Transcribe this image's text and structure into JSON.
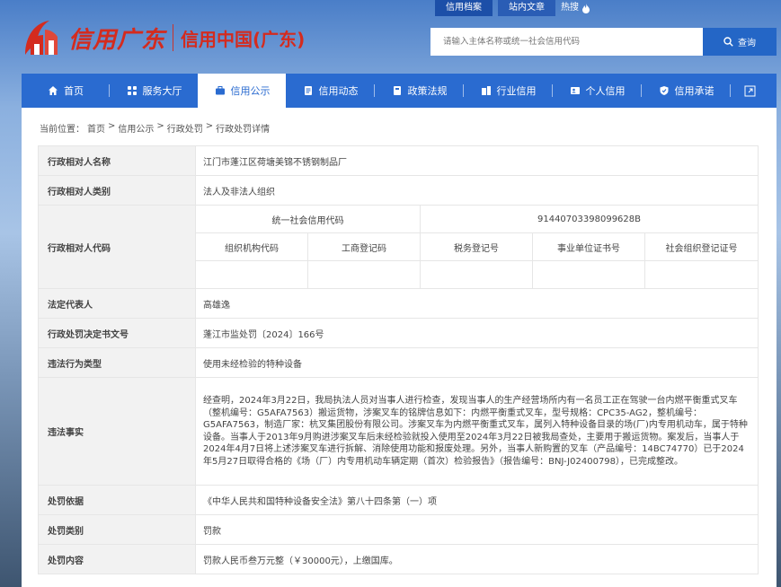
{
  "header": {
    "logo_script": "信用广东",
    "logo_title": "信用中国(广东)",
    "top_links": [
      "信用档案",
      "站内文章"
    ],
    "hot_label": "热搜",
    "search_placeholder": "请输入主体名称或统一社会信用代码",
    "search_button": "查询"
  },
  "nav": {
    "items": [
      {
        "label": "首页",
        "icon": "home-icon"
      },
      {
        "label": "服务大厅",
        "icon": "grid-icon"
      },
      {
        "label": "信用公示",
        "icon": "briefcase-icon",
        "active": true
      },
      {
        "label": "信用动态",
        "icon": "document-icon"
      },
      {
        "label": "政策法规",
        "icon": "book-icon"
      },
      {
        "label": "行业信用",
        "icon": "building-icon"
      },
      {
        "label": "个人信用",
        "icon": "person-card-icon"
      },
      {
        "label": "信用承诺",
        "icon": "shield-check-icon"
      }
    ],
    "expand_icon": "external-link-icon"
  },
  "breadcrumb": {
    "prefix": "当前位置：",
    "items": [
      "首页",
      "信用公示",
      "行政处罚",
      "行政处罚详情"
    ],
    "separator": ">"
  },
  "detail": {
    "name_label": "行政相对人名称",
    "name_value": "江门市蓬江区荷塘美锦不锈钢制品厂",
    "category_label": "行政相对人类别",
    "category_value": "法人及非法人组织",
    "code_label": "行政相对人代码",
    "uscc_label": "统一社会信用代码",
    "uscc_value": "91440703398099628B",
    "code_columns": [
      "组织机构代码",
      "工商登记码",
      "税务登记号",
      "事业单位证书号",
      "社会组织登记证号"
    ],
    "legal_rep_label": "法定代表人",
    "legal_rep_value": "高雄逸",
    "decision_no_label": "行政处罚决定书文号",
    "decision_no_value": "蓬江市监处罚〔2024〕166号",
    "violation_type_label": "违法行为类型",
    "violation_type_value": "使用未经检验的特种设备",
    "facts_label": "违法事实",
    "facts_value": "经查明，2024年3月22日，我局执法人员对当事人进行检查，发现当事人的生产经营场所内有一名员工正在驾驶一台内燃平衡重式叉车（整机编号：G5AFA7563）搬运货物，涉案叉车的铭牌信息如下：内燃平衡重式叉车，型号规格：CPC35-AG2，整机编号：G5AFA7563，制造厂家：杭叉集团股份有限公司。涉案叉车为内燃平衡重式叉车，属列入特种设备目录的场(厂)内专用机动车，属于特种设备。当事人于2013年9月购进涉案叉车后未经检验就投入使用至2024年3月22日被我局查处，主要用于搬运货物。案发后，当事人于2024年4月7日将上述涉案叉车进行拆解、消除使用功能和报废处理。另外，当事人新购置的叉车（产品编号：14BC74770）已于2024年5月27日取得合格的《场（厂）内专用机动车辆定期（首次）检验报告》（报告编号：BNJ-J02400798），已完成整改。",
    "basis_label": "处罚依据",
    "basis_value": "《中华人民共和国特种设备安全法》第八十四条第（一）项",
    "penalty_type_label": "处罚类别",
    "penalty_type_value": "罚款",
    "penalty_content_label": "处罚内容",
    "penalty_content_value": "罚款人民币叁万元整（￥30000元），上缴国库。"
  },
  "colors": {
    "brand_red": "#d42b1e",
    "nav_blue": "#2a6bd0",
    "label_bg": "#f2f2f2"
  }
}
